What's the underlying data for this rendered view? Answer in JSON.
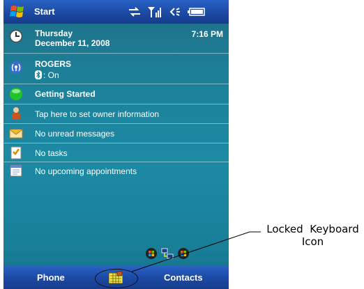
{
  "taskbar": {
    "start_label": "Start"
  },
  "date_item": {
    "day": "Thursday",
    "date": "December 11, 2008",
    "time": "7:16 PM"
  },
  "carrier_item": {
    "name": "ROGERS",
    "bluetooth_status": ": On"
  },
  "getting_started": {
    "label": "Getting Started"
  },
  "owner_item": {
    "label": "Tap here to set owner information"
  },
  "messages_item": {
    "label": "No unread messages"
  },
  "tasks_item": {
    "label": "No tasks"
  },
  "appointments_item": {
    "label": "No upcoming appointments"
  },
  "softkeys": {
    "left": "Phone",
    "right": "Contacts"
  },
  "callout": {
    "line1": "Locked  Keyboard",
    "line2": "Icon"
  },
  "colors": {
    "title_bar": "#1c49a3",
    "background": "#1d8aa4",
    "getting_started_icon": "#22c22a"
  }
}
